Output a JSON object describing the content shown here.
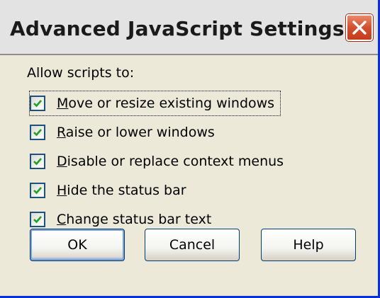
{
  "window": {
    "title": "Advanced JavaScript Settings",
    "close_icon": "close-icon"
  },
  "group": {
    "label": "Allow scripts to:"
  },
  "options": [
    {
      "prefix": "",
      "mnemonic": "M",
      "rest": "ove or resize existing windows",
      "checked": true,
      "focused": true
    },
    {
      "prefix": "",
      "mnemonic": "R",
      "rest": "aise or lower windows",
      "checked": true,
      "focused": false
    },
    {
      "prefix": "",
      "mnemonic": "D",
      "rest": "isable or replace context menus",
      "checked": true,
      "focused": false
    },
    {
      "prefix": "",
      "mnemonic": "H",
      "rest": "ide the status bar",
      "checked": true,
      "focused": false
    },
    {
      "prefix": "",
      "mnemonic": "C",
      "rest": "hange status bar text",
      "checked": true,
      "focused": false
    }
  ],
  "buttons": {
    "ok": "OK",
    "cancel": "Cancel",
    "help": "Help"
  },
  "colors": {
    "check": "#21a121",
    "titlebar": "#e3e3e3",
    "close": "#d2502f",
    "face": "#ece9d8"
  }
}
